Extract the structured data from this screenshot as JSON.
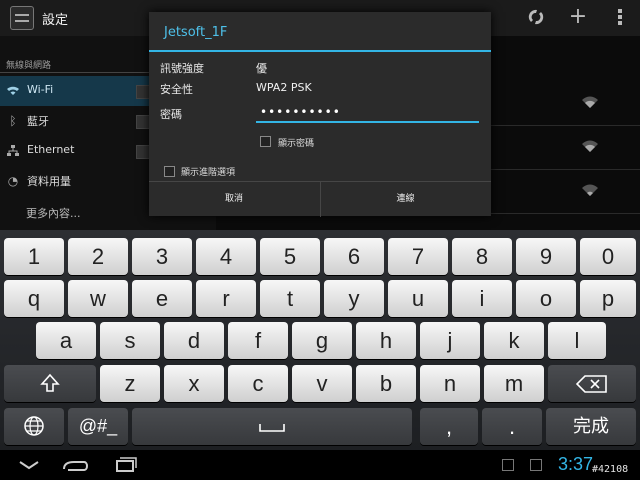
{
  "app": {
    "title": "設定"
  },
  "actionbar": {
    "icons": [
      "wps-icon",
      "add-icon",
      "overflow-menu-icon"
    ]
  },
  "left_pane": {
    "section_header": "無線與網路",
    "items": [
      {
        "label": "Wi-Fi",
        "icon": "wifi-icon",
        "selected": true
      },
      {
        "label": "藍牙",
        "icon": "bluetooth-icon"
      },
      {
        "label": "Ethernet",
        "icon": "ethernet-icon"
      },
      {
        "label": "資料用量",
        "icon": "data-usage-icon"
      },
      {
        "label": "更多內容..."
      }
    ]
  },
  "dialog": {
    "title": "Jetsoft_1F",
    "signal_label": "訊號強度",
    "signal_value": "優",
    "security_label": "安全性",
    "security_value": "WPA2 PSK",
    "password_label": "密碼",
    "password_value": "••••••••••",
    "show_password_label": "顯示密碼",
    "advanced_label": "顯示進階選項",
    "cancel_label": "取消",
    "connect_label": "連線"
  },
  "keyboard": {
    "rows": [
      [
        "1",
        "2",
        "3",
        "4",
        "5",
        "6",
        "7",
        "8",
        "9",
        "0"
      ],
      [
        "q",
        "w",
        "e",
        "r",
        "t",
        "y",
        "u",
        "i",
        "o",
        "p"
      ],
      [
        "a",
        "s",
        "d",
        "f",
        "g",
        "h",
        "j",
        "k",
        "l"
      ],
      [
        "z",
        "x",
        "c",
        "v",
        "b",
        "n",
        "m"
      ]
    ],
    "symbols_label": "@#_",
    "comma_label": ",",
    "period_label": ".",
    "done_label": "完成"
  },
  "statusbar": {
    "time": "3:37",
    "watermark": "#42108"
  },
  "colors": {
    "accent": "#33b5e5",
    "wifi_selected_bg": "#15384a"
  }
}
